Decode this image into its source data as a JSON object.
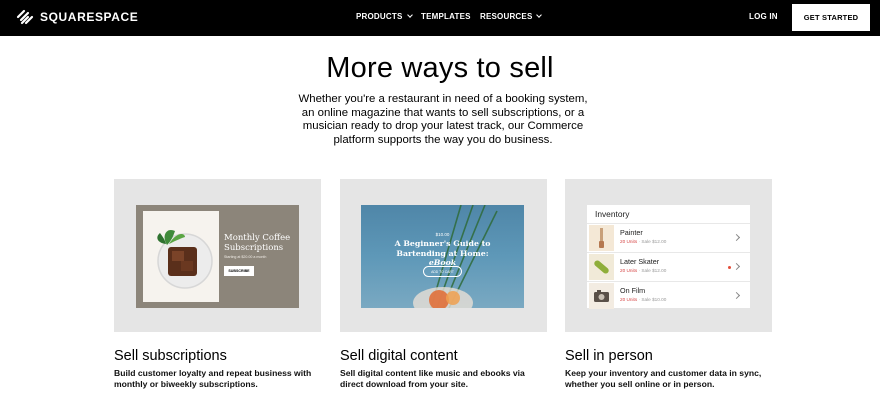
{
  "nav": {
    "brand": "SQUARESPACE",
    "products": "PRODUCTS",
    "templates": "TEMPLATES",
    "resources": "RESOURCES",
    "login": "LOG IN",
    "get_started": "GET STARTED"
  },
  "hero": {
    "heading": "More ways to sell",
    "subheading": "Whether you're a restaurant in need of a booking system, an online magazine that wants to sell subscriptions, or a musician ready to drop your latest track, our Commerce platform supports the way you do business."
  },
  "cards": [
    {
      "title": "Sell subscriptions",
      "description": "Build customer loyalty and repeat business with monthly or biweekly subscriptions.",
      "mock": {
        "title": "Monthly Coffee Subscriptions",
        "small": "Starting at $20.00 a month",
        "button": "SUBSCRIBE"
      }
    },
    {
      "title": "Sell digital content",
      "description": "Sell digital content like music and ebooks via direct download from your site.",
      "mock": {
        "price": "$10.00",
        "title_line1": "A Beginner's Guide to",
        "title_line2": "Bartending at Home: ",
        "title_em": "eBook",
        "button": "ADD TO CART"
      }
    },
    {
      "title": "Sell in person",
      "description": "Keep your inventory and customer data in sync, whether you sell online or in person.",
      "mock": {
        "title": "Inventory",
        "items": [
          {
            "name": "Painter",
            "units": "20 Units",
            "sale": "· Sale $12.00"
          },
          {
            "name": "Later Skater",
            "units": "20 Units",
            "sale": "· Sale $12.00"
          },
          {
            "name": "On Film",
            "units": "20 Units",
            "sale": "· Sale $10.00"
          }
        ]
      }
    }
  ],
  "colors": {
    "nav_bg": "#000000",
    "card_bg": "#e5e5e5",
    "subscription_panel": "#8c857a",
    "ebook_blue": "#5e98b8",
    "alert_red": "#d64545"
  }
}
